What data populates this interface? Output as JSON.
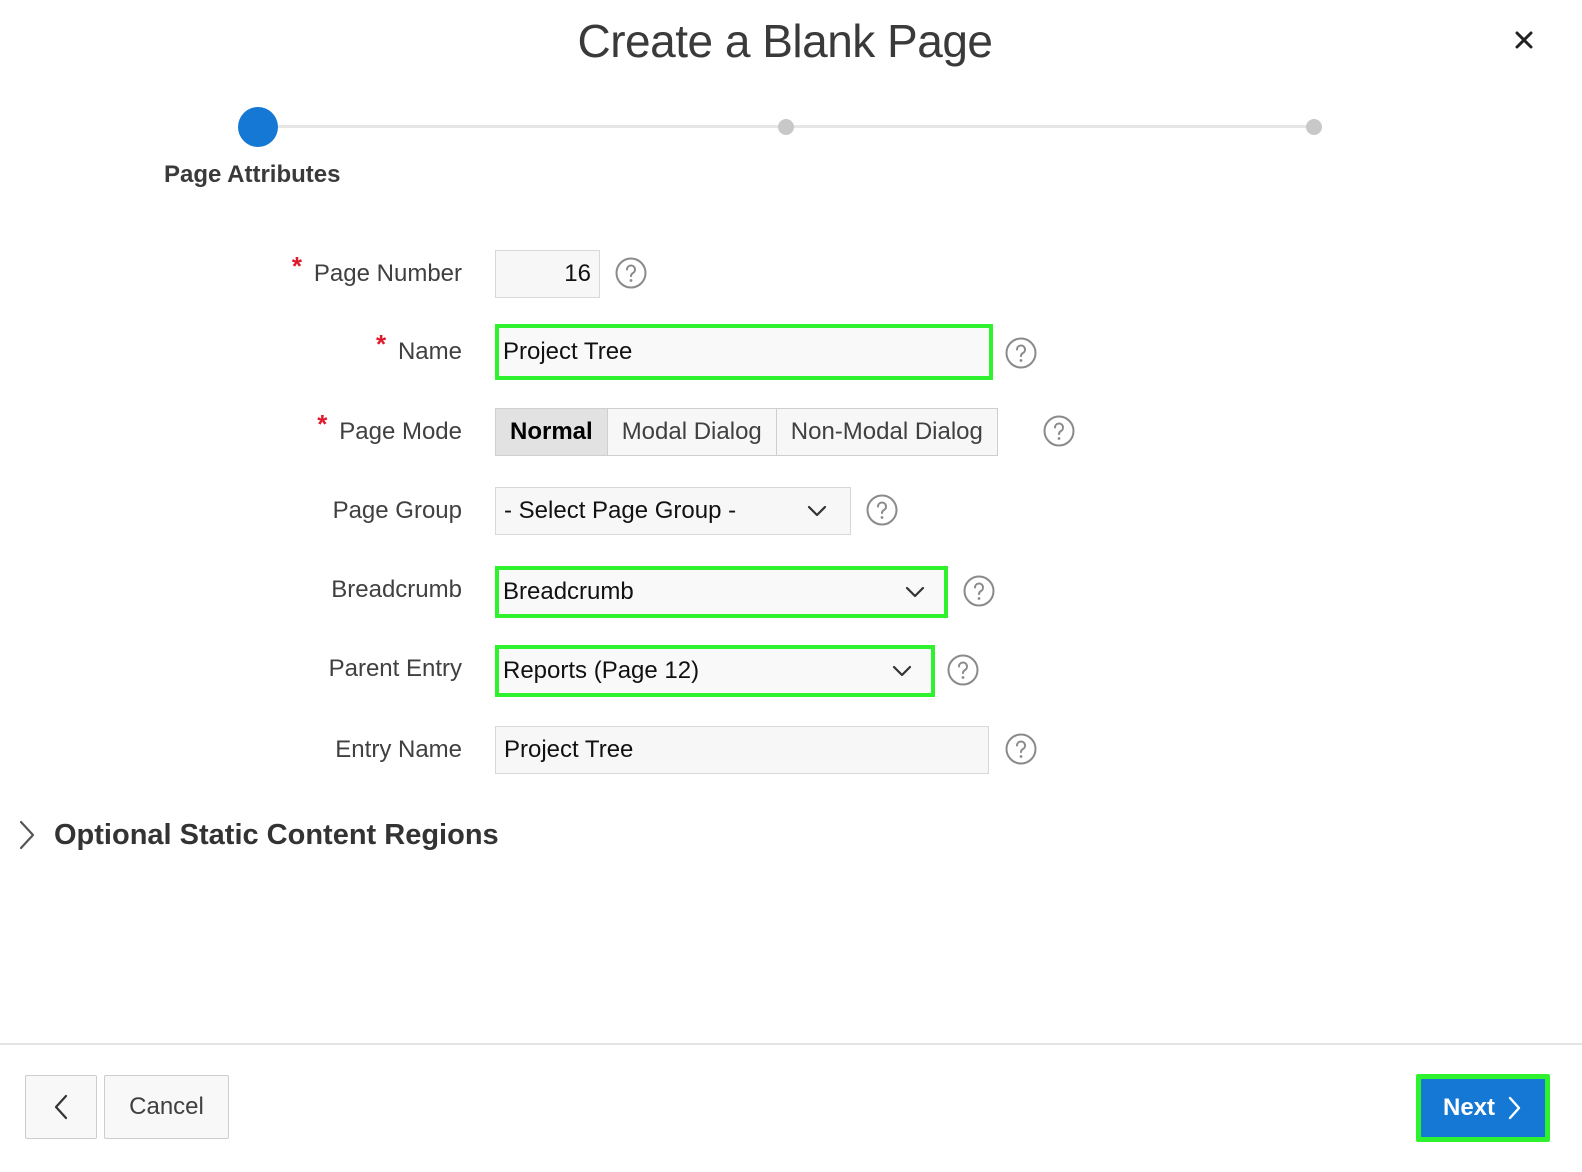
{
  "dialog": {
    "title": "Create a Blank Page",
    "close_icon": "close-icon"
  },
  "wizard": {
    "current_step_label": "Page Attributes",
    "total_steps": 3,
    "current_step": 1
  },
  "form": {
    "page_number": {
      "label": "Page Number",
      "value": "16",
      "required": true
    },
    "name": {
      "label": "Name",
      "value": "Project Tree",
      "required": true
    },
    "page_mode": {
      "label": "Page Mode",
      "required": true,
      "options": [
        "Normal",
        "Modal Dialog",
        "Non-Modal Dialog"
      ],
      "selected": "Normal"
    },
    "page_group": {
      "label": "Page Group",
      "value": "- Select Page Group -"
    },
    "breadcrumb": {
      "label": "Breadcrumb",
      "value": "Breadcrumb"
    },
    "parent_entry": {
      "label": "Parent Entry",
      "value": "Reports (Page 12)"
    },
    "entry_name": {
      "label": "Entry Name",
      "value": "Project Tree"
    },
    "required_marker": "*",
    "help_icon": "help-icon"
  },
  "optional_section": {
    "label": "Optional Static Content Regions",
    "icon": "chevron-right-icon"
  },
  "footer": {
    "back_icon": "chevron-left-icon",
    "cancel_label": "Cancel",
    "next_label": "Next"
  },
  "colors": {
    "accent": "#1478d4",
    "required": "#e0192b",
    "highlight": "#2ef22e"
  }
}
